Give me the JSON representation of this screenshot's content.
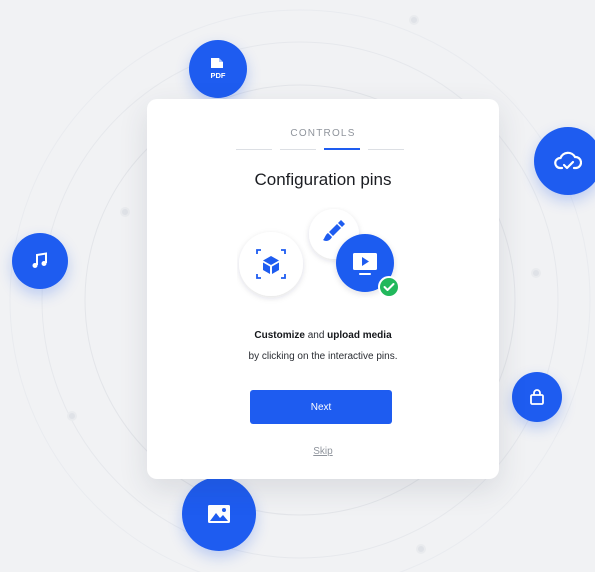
{
  "header": {
    "step_label": "CONTROLS"
  },
  "main": {
    "title": "Configuration pins",
    "description": {
      "bold_1": "Customize",
      "and": " and ",
      "bold_2": "upload media",
      "line_2": "by clicking on the interactive pins."
    },
    "next_label": "Next",
    "skip_label": "Skip"
  },
  "pins": {
    "pdf_label": "PDF"
  },
  "colors": {
    "accent": "#1e5cf0",
    "success": "#22b85c",
    "background": "#f1f2f4",
    "card": "#ffffff"
  },
  "icons": [
    "pdf-icon",
    "music-note-icon",
    "cloud-check-icon",
    "shopping-bag-icon",
    "image-icon",
    "cube-icon",
    "paint-brush-icon",
    "monitor-play-icon",
    "check-icon"
  ],
  "steps": {
    "total": 4,
    "active": 3
  }
}
